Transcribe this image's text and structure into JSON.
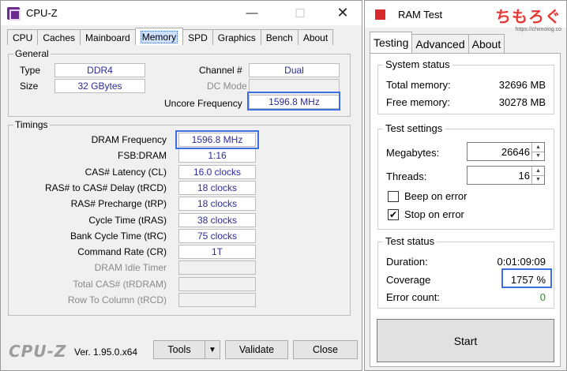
{
  "cpuz": {
    "title": "CPU-Z",
    "tabs": [
      "CPU",
      "Caches",
      "Mainboard",
      "Memory",
      "SPD",
      "Graphics",
      "Bench",
      "About"
    ],
    "active_tab": "Memory",
    "general": {
      "group_title": "General",
      "type_label": "Type",
      "type_value": "DDR4",
      "size_label": "Size",
      "size_value": "32 GBytes",
      "channel_label": "Channel #",
      "channel_value": "Dual",
      "dc_mode_label": "DC Mode",
      "dc_mode_value": "",
      "uncore_label": "Uncore Frequency",
      "uncore_value": "1596.8 MHz"
    },
    "timings": {
      "group_title": "Timings",
      "rows": [
        {
          "label": "DRAM Frequency",
          "value": "1596.8 MHz"
        },
        {
          "label": "FSB:DRAM",
          "value": "1:16"
        },
        {
          "label": "CAS# Latency (CL)",
          "value": "16.0 clocks"
        },
        {
          "label": "RAS# to CAS# Delay (tRCD)",
          "value": "18 clocks"
        },
        {
          "label": "RAS# Precharge (tRP)",
          "value": "18 clocks"
        },
        {
          "label": "Cycle Time (tRAS)",
          "value": "38 clocks"
        },
        {
          "label": "Bank Cycle Time (tRC)",
          "value": "75 clocks"
        },
        {
          "label": "Command Rate (CR)",
          "value": "1T"
        },
        {
          "label": "DRAM Idle Timer",
          "value": ""
        },
        {
          "label": "Total CAS# (tRDRAM)",
          "value": ""
        },
        {
          "label": "Row To Column (tRCD)",
          "value": ""
        }
      ]
    },
    "footer": {
      "logo": "CPU-Z",
      "version": "Ver. 1.95.0.x64",
      "tools_label": "Tools",
      "validate_label": "Validate",
      "close_label": "Close"
    }
  },
  "ramtest": {
    "title": "RAM Test",
    "watermark": "ちもろぐ",
    "watermark_url": "https://chimolog.co",
    "tabs": [
      "Testing",
      "Advanced",
      "About"
    ],
    "active_tab": "Testing",
    "system_status": {
      "group_title": "System status",
      "total_label": "Total memory:",
      "total_value": "32696 MB",
      "free_label": "Free memory:",
      "free_value": "30278 MB"
    },
    "test_settings": {
      "group_title": "Test settings",
      "megabytes_label": "Megabytes:",
      "megabytes_value": "26646",
      "threads_label": "Threads:",
      "threads_value": "16",
      "beep_label": "Beep on error",
      "beep_checked": false,
      "stop_label": "Stop on error",
      "stop_checked": true
    },
    "test_status": {
      "group_title": "Test status",
      "duration_label": "Duration:",
      "duration_value": "0:01:09:09",
      "coverage_label": "Coverage",
      "coverage_value": "1757 %",
      "error_label": "Error count:",
      "error_value": "0"
    },
    "start_label": "Start"
  },
  "colors": {
    "highlight": "#3d6fe0",
    "value_text": "#2b2b9e",
    "error_zero": "#1a9a1a",
    "watermark": "#e53935"
  }
}
